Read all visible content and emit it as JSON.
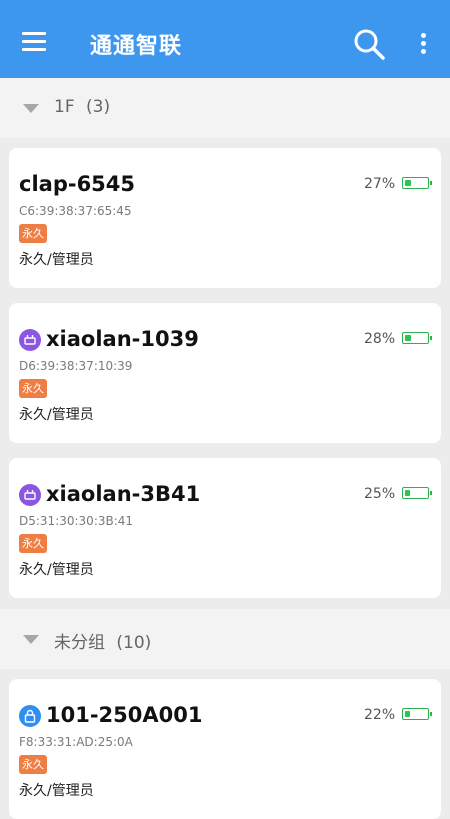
{
  "app": {
    "title": "通通智联"
  },
  "groups": [
    {
      "name": "1F",
      "count": "(3)"
    },
    {
      "name": "未分组",
      "count": "(10)"
    }
  ],
  "devices": [
    {
      "name": "clap-6545",
      "mac": "C6:39:38:37:65:45",
      "badge": "永久",
      "permission": "永久/管理员",
      "battery": "27%",
      "battery_level": 0.27,
      "icon": "none"
    },
    {
      "name": "xiaolan-1039",
      "mac": "D6:39:38:37:10:39",
      "badge": "永久",
      "permission": "永久/管理员",
      "battery": "28%",
      "battery_level": 0.28,
      "icon": "router-icon",
      "icon_color": "#8a56e2"
    },
    {
      "name": "xiaolan-3B41",
      "mac": "D5:31:30:30:3B:41",
      "badge": "永久",
      "permission": "永久/管理员",
      "battery": "25%",
      "battery_level": 0.25,
      "icon": "router-icon",
      "icon_color": "#8a56e2"
    },
    {
      "name": "101-250A001",
      "mac": "F8:33:31:AD:25:0A",
      "badge": "永久",
      "permission": "永久/管理员",
      "battery": "22%",
      "battery_level": 0.22,
      "icon": "lock-device-icon",
      "icon_color": "#2f8ff0"
    }
  ],
  "colors": {
    "appbar": "#3d97ef",
    "badge": "#ef7e45",
    "battery": "#2cb24b"
  }
}
